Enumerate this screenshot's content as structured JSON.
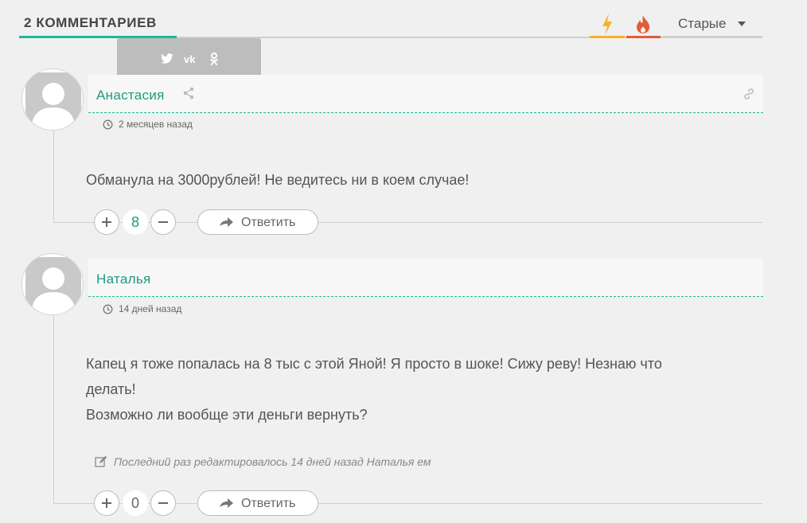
{
  "header": {
    "comments_count_label": "2 КОММЕНТАРИЕВ",
    "sort_label": "Старые",
    "tab_icons": [
      "bolt-icon",
      "fire-icon"
    ],
    "colors": {
      "accent": "#1db99a",
      "bolt": "#f3b525",
      "fire": "#e45b39"
    }
  },
  "share_tooltip": {
    "icons": [
      "twitter-icon",
      "vk-icon",
      "odnoklassniki-icon"
    ]
  },
  "comments": [
    {
      "author": "Анастасия",
      "time": "2 месяцев назад",
      "text_lines": [
        "Обманула на 3000рублей! Не ведитесь ни в коем случае!"
      ],
      "votes": "8",
      "reply_label": "Ответить"
    },
    {
      "author": "Наталья",
      "time": "14 дней назад",
      "text_lines": [
        "Капец я тоже попалась на 8 тыс с этой Яной! Я просто в шоке! Сижу реву! Незнаю что",
        "делать!",
        "Возможно ли вообще эти деньги вернуть?"
      ],
      "edited_note": "Последний раз редактировалось 14 дней назад Наталья ем",
      "votes": "0",
      "reply_label": "Ответить"
    }
  ]
}
